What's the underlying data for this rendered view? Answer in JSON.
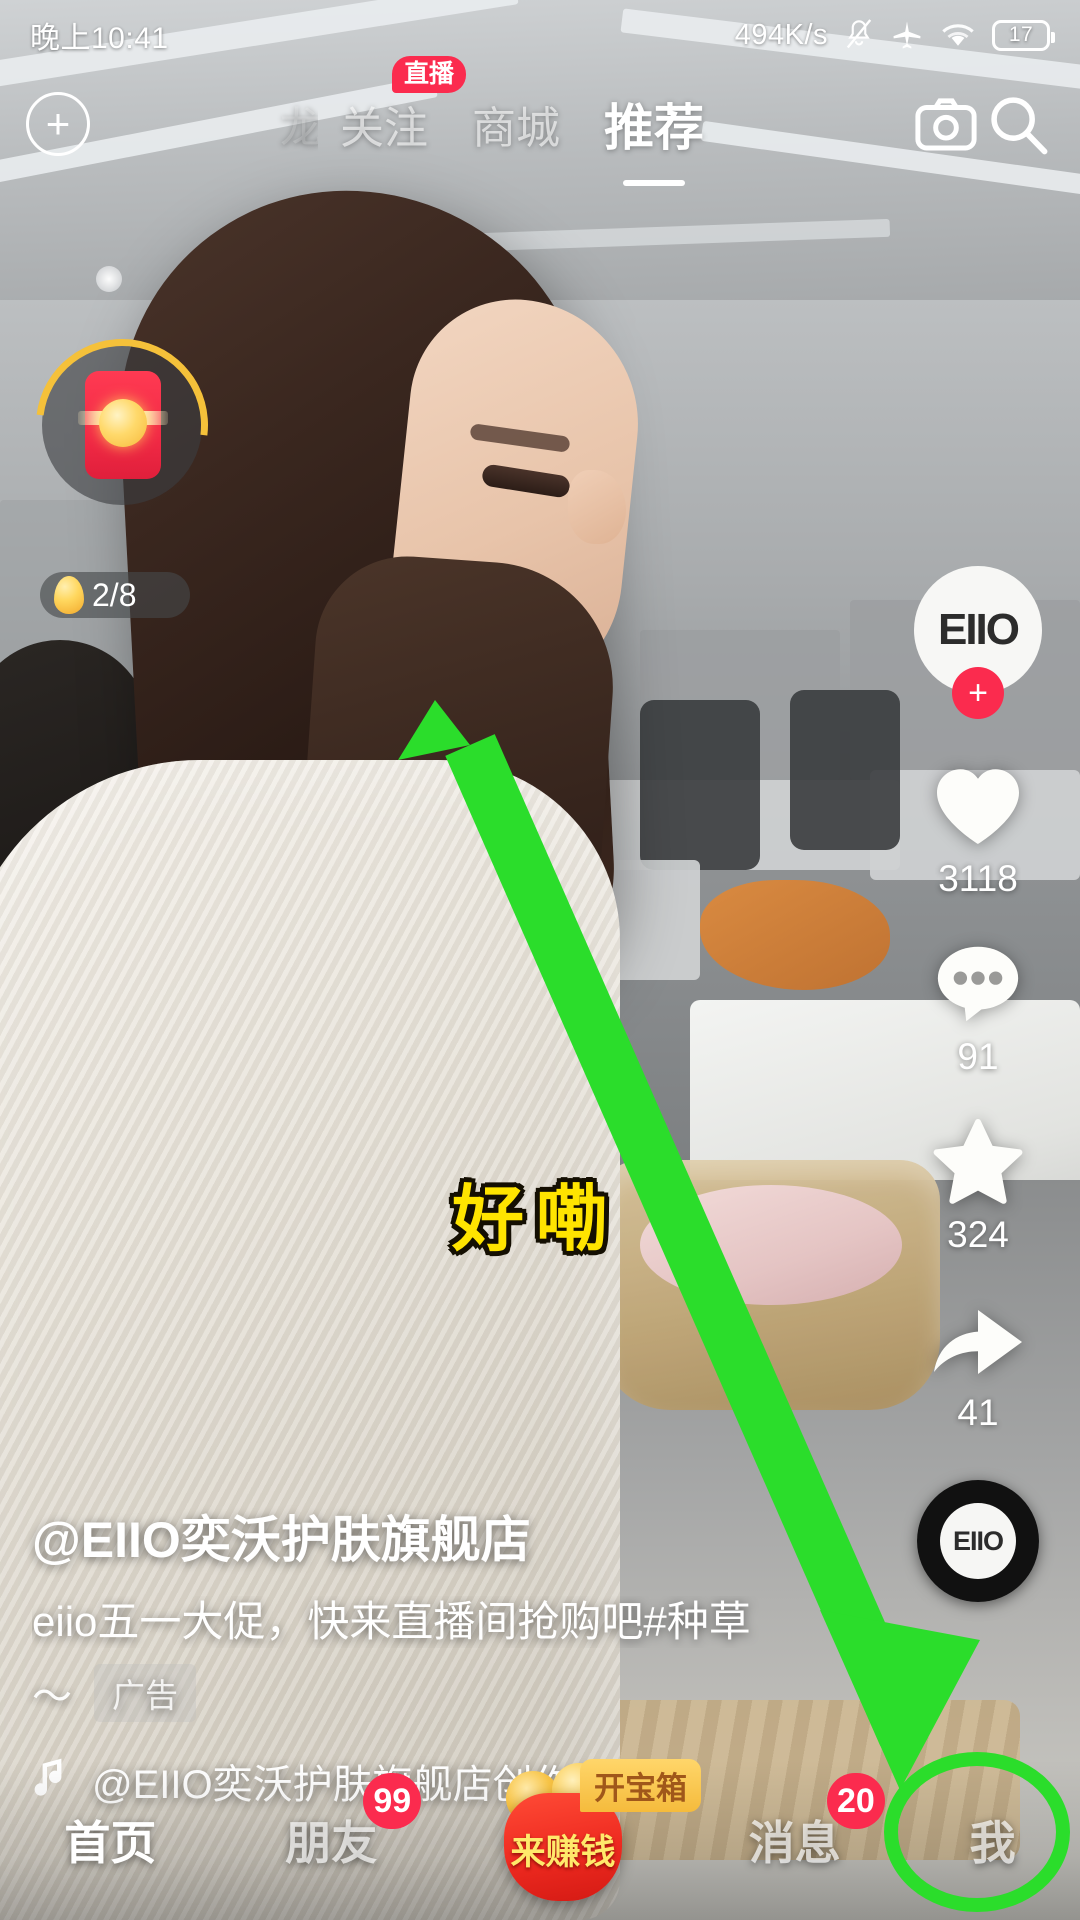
{
  "status_bar": {
    "time": "晚上10:41",
    "network_speed": "494K/s",
    "mute_icon": "bell-muted-icon",
    "airplane_icon": "airplane-mode-icon",
    "wifi_icon": "wifi-icon",
    "battery_level": "17"
  },
  "top_nav": {
    "add_label": "+",
    "ghost_tab": "龙",
    "tabs": [
      {
        "label": "关注",
        "active": false
      },
      {
        "label": "商城",
        "active": false
      },
      {
        "label": "推荐",
        "active": true
      }
    ],
    "live_badge": "直播",
    "camera_icon": "camera-icon",
    "search_icon": "search-icon"
  },
  "red_packet": {
    "icon": "red-envelope-icon",
    "progress_label": "2/8",
    "egg_icon": "golden-egg-icon"
  },
  "action_rail": {
    "avatar_text": "EIIO",
    "follow_label": "+",
    "like": {
      "icon": "heart-icon",
      "count": "3118"
    },
    "comment": {
      "icon": "comment-bubble-icon",
      "count": "91"
    },
    "favorite": {
      "icon": "star-icon",
      "count": "324"
    },
    "share": {
      "icon": "share-arrow-icon",
      "count": "41"
    },
    "music_disc_text": "EIIO"
  },
  "video": {
    "subtitle": "好嘞"
  },
  "caption": {
    "username": "@EIIO奕沃护肤旗舰店",
    "text": "eiio五一大促，快来直播间抢购吧#种草",
    "wave": "～",
    "ad_label": "广告",
    "music_icon": "music-note-icon",
    "music_text": "@EIIO奕沃护肤旗舰店创作的原声"
  },
  "tab_bar": {
    "items": [
      {
        "label": "首页",
        "active": true,
        "badge": null
      },
      {
        "label": "朋友",
        "active": false,
        "badge": "99"
      },
      {
        "label": "消息",
        "active": false,
        "badge": "20"
      },
      {
        "label": "我",
        "active": false,
        "badge": null
      }
    ],
    "earn": {
      "label": "来赚钱",
      "chest_label": "开宝箱",
      "icon": "money-bag-icon"
    }
  },
  "annotation": {
    "arrow_color": "#2bdd2b",
    "circle_target": "我"
  },
  "colors": {
    "accent_red": "#fb2b4e",
    "subtitle_yellow": "#ffe400",
    "ring_gold": "#f5c13a",
    "annotation_green": "#2bdd2b"
  }
}
